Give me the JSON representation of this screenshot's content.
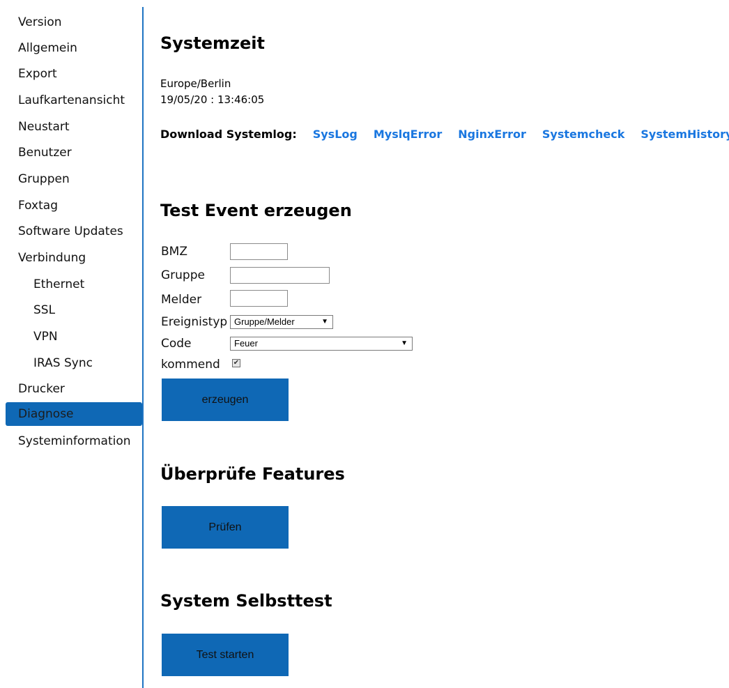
{
  "sidebar": {
    "items": [
      {
        "label": "Version"
      },
      {
        "label": "Allgemein"
      },
      {
        "label": "Export"
      },
      {
        "label": "Laufkartenansicht"
      },
      {
        "label": "Neustart"
      },
      {
        "label": "Benutzer"
      },
      {
        "label": "Gruppen"
      },
      {
        "label": "Foxtag"
      },
      {
        "label": "Software Updates"
      },
      {
        "label": "Verbindung"
      },
      {
        "label": "Ethernet"
      },
      {
        "label": "SSL"
      },
      {
        "label": "VPN"
      },
      {
        "label": "IRAS Sync"
      },
      {
        "label": "Drucker"
      },
      {
        "label": "Diagnose"
      },
      {
        "label": "Systeminformation"
      }
    ],
    "active": "Diagnose"
  },
  "systemzeit": {
    "title": "Systemzeit",
    "timezone": "Europe/Berlin",
    "datetime": "19/05/20 : 13:46:05"
  },
  "download": {
    "label": "Download Systemlog:",
    "links": [
      "SysLog",
      "MyslqError",
      "NginxError",
      "Systemcheck",
      "SystemHistory"
    ]
  },
  "test_event": {
    "title": "Test Event erzeugen",
    "bmz_label": "BMZ",
    "bmz_value": "",
    "gruppe_label": "Gruppe",
    "gruppe_value": "",
    "melder_label": "Melder",
    "melder_value": "",
    "ereignistyp_label": "Ereignistyp",
    "ereignistyp_value": "Gruppe/Melder",
    "code_label": "Code",
    "code_value": "Feuer",
    "kommend_label": "kommend",
    "kommend_checked": true,
    "submit_label": "erzeugen"
  },
  "features": {
    "title": "Überprüfe Features",
    "button_label": "Prüfen"
  },
  "selbsttest": {
    "title": "System Selbsttest",
    "button_label": "Test starten"
  },
  "colors": {
    "accent": "#0f68b5",
    "link": "#1a77e0",
    "divider": "#1f74c2"
  }
}
